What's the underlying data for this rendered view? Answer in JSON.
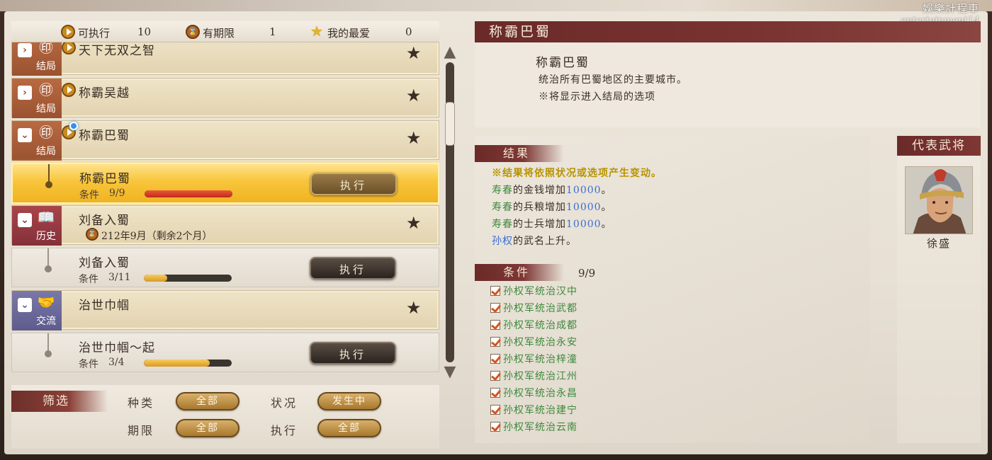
{
  "watermark": {
    "line1": "娛樂計程車",
    "line2": "entertainment14"
  },
  "stats": {
    "executable_label": "可执行",
    "executable_count": "10",
    "limited_label": "有期限",
    "limited_count": "1",
    "favorite_label": "我的最爱",
    "favorite_count": "0"
  },
  "list": {
    "rows": [
      {
        "tag": "结局",
        "title": "天下无双之智",
        "favorite": "★"
      },
      {
        "tag": "结局",
        "title": "称霸吴越",
        "favorite": "★"
      },
      {
        "tag": "结局",
        "title": "称霸巴蜀",
        "favorite": "★"
      },
      {
        "title": "称霸巴蜀",
        "cond_label": "条件",
        "cond_value": "9/9",
        "progress": 1.0,
        "button": "执行"
      },
      {
        "tag": "历史",
        "title": "刘备入蜀",
        "deadline": "212年9月（剩余2个月）",
        "favorite": "★"
      },
      {
        "title": "刘备入蜀",
        "cond_label": "条件",
        "cond_value": "3/11",
        "progress": 0.27,
        "button": "执行"
      },
      {
        "tag": "交流",
        "title": "治世巾帼",
        "favorite": "★"
      },
      {
        "title": "治世巾帼～起",
        "cond_label": "条件",
        "cond_value": "3/4",
        "progress": 0.75,
        "button": "执行"
      }
    ]
  },
  "filter": {
    "title": "筛选",
    "type_label": "种类",
    "type_value": "全部",
    "status_label": "状况",
    "status_value": "发生中",
    "period_label": "期限",
    "period_value": "全部",
    "execute_label": "执行",
    "execute_value": "全部"
  },
  "detail": {
    "header": "称霸巴蜀",
    "title": "称霸巴蜀",
    "desc_line1": "统治所有巴蜀地区的主要城市。",
    "desc_line2": "※将显示进入结局的选项"
  },
  "result": {
    "section": "结果",
    "warning": "※结果将依照状况或选项产生变动。",
    "lines": [
      {
        "who": "寿春",
        "text": "的金钱增加",
        "value": "10000",
        "end": "。"
      },
      {
        "who": "寿春",
        "text": "的兵粮增加",
        "value": "10000",
        "end": "。"
      },
      {
        "who": "寿春",
        "text": "的士兵增加",
        "value": "10000",
        "end": "。"
      },
      {
        "who": "孙权",
        "text": "的武名上升。",
        "value": "",
        "end": ""
      }
    ]
  },
  "conditions": {
    "section": "条件",
    "count": "9/9",
    "items": [
      "孙权军统治汉中",
      "孙权军统治武都",
      "孙权军统治成都",
      "孙权军统治永安",
      "孙权军统治梓潼",
      "孙权军统治江州",
      "孙权军统治永昌",
      "孙权军统治建宁",
      "孙权军统治云南"
    ]
  },
  "officer": {
    "section": "代表武将",
    "name": "徐盛"
  },
  "colors": {
    "accent_red": "#6a2a28",
    "selected_gold": "#f8c53a",
    "condition_green": "#3e8a3e",
    "value_blue": "#3a6ed0"
  }
}
